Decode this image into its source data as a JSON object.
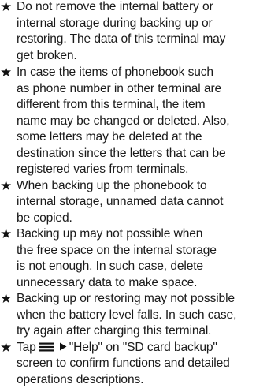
{
  "bullet_symbol": "★",
  "notes": [
    {
      "lines": [
        "Do not remove the internal battery or",
        "internal storage during backing up or",
        "restoring. The data of this terminal may",
        "get broken."
      ]
    },
    {
      "lines": [
        "In case the items of phonebook such",
        "as phone number in other terminal are",
        "different from this terminal, the item",
        "name may be changed or deleted. Also,",
        "some letters may be deleted at the",
        "destination since the letters that can be",
        "registered varies from terminals."
      ]
    },
    {
      "lines": [
        "When backing up the phonebook to",
        "internal storage, unnamed data cannot",
        "be copied."
      ]
    },
    {
      "lines": [
        "Backing up may not possible when",
        "the free space on the internal storage",
        "is not enough. In such case, delete",
        "unnecessary data to make space."
      ]
    },
    {
      "lines": [
        "Backing up or restoring may not possible",
        "when the battery level falls. In such case,",
        "try again after charging this terminal."
      ]
    },
    {
      "first_prefix": "Tap",
      "first_suffix": "\"Help\" on \"SD card backup\"",
      "first_line_icons": [
        "menu-icon",
        "right-arrow-icon"
      ],
      "lines": [
        "screen to confirm functions and detailed",
        "operations descriptions."
      ]
    }
  ]
}
